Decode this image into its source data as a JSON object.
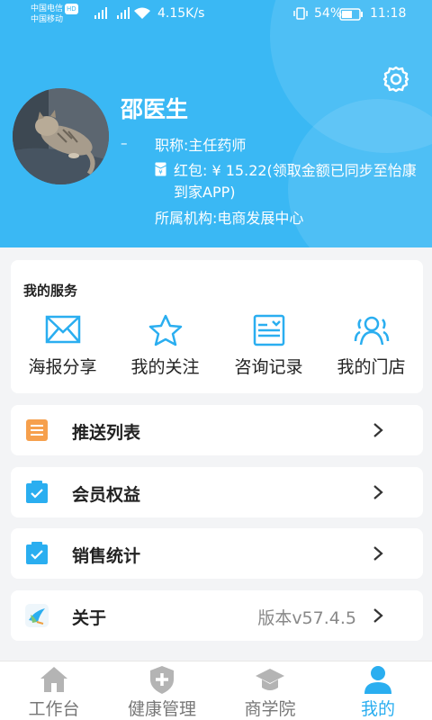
{
  "status_bar": {
    "carrier1": "中国电信",
    "hd": "HD",
    "carrier2": "中国移动",
    "speed": "4.15K/s",
    "battery": "54%",
    "time": "11:18"
  },
  "profile": {
    "name": "邵医生",
    "dash": "–",
    "title": "职称:主任药师",
    "red_packet": "红包: ¥ 15.22(领取金额已同步至怡康到家APP)",
    "org": "所属机构:电商发展中心"
  },
  "services": {
    "title": "我的服务",
    "items": [
      {
        "label": "海报分享",
        "icon": "envelope-icon"
      },
      {
        "label": "我的关注",
        "icon": "star-icon"
      },
      {
        "label": "咨询记录",
        "icon": "record-icon"
      },
      {
        "label": "我的门店",
        "icon": "users-icon"
      }
    ]
  },
  "menu": [
    {
      "label": "推送列表",
      "icon": "list-icon",
      "value": ""
    },
    {
      "label": "会员权益",
      "icon": "checkbox-icon",
      "value": ""
    },
    {
      "label": "销售统计",
      "icon": "checkbox-icon",
      "value": ""
    },
    {
      "label": "关于",
      "icon": "bird-logo-icon",
      "value": "版本v57.4.5"
    }
  ],
  "tabs": [
    {
      "label": "工作台",
      "icon": "home-icon",
      "active": false
    },
    {
      "label": "健康管理",
      "icon": "shield-plus-icon",
      "active": false
    },
    {
      "label": "商学院",
      "icon": "graduation-cap-icon",
      "active": false
    },
    {
      "label": "我的",
      "icon": "person-icon",
      "active": true
    }
  ],
  "colors": {
    "header": "#3ab8f4",
    "accent": "#2aaef0",
    "list_orange": "#f6a04d"
  }
}
